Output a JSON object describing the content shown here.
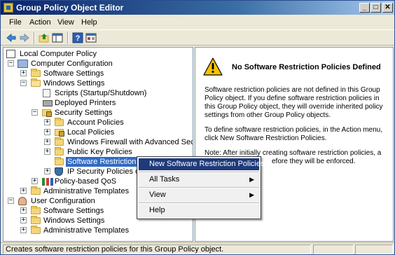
{
  "window": {
    "title": "Group Policy Object Editor",
    "minimize_glyph": "_",
    "maximize_glyph": "□",
    "close_glyph": "✕"
  },
  "menu": [
    "File",
    "Action",
    "View",
    "Help"
  ],
  "toolbar": {
    "icons": [
      "back-arrow-icon",
      "forward-arrow-icon",
      "up-folder-icon",
      "show-hide-tree-icon",
      "help-icon",
      "properties-icon"
    ]
  },
  "tree": {
    "root": "Local Computer Policy",
    "computer_configuration": "Computer Configuration",
    "software_settings": "Software Settings",
    "windows_settings": "Windows Settings",
    "scripts": "Scripts (Startup/Shutdown)",
    "deployed_printers": "Deployed Printers",
    "security_settings": "Security Settings",
    "account_policies": "Account Policies",
    "local_policies": "Local Policies",
    "windows_firewall": "Windows Firewall with Advanced Security",
    "public_key_policies": "Public Key Policies",
    "software_restriction": "Software Restriction Polic",
    "ip_security": "IP Security Policies on Lo",
    "policy_qos": "Policy-based QoS",
    "admin_templates": "Administrative Templates",
    "user_configuration": "User Configuration",
    "user_software_settings": "Software Settings",
    "user_windows_settings": "Windows Settings",
    "user_admin_templates": "Administrative Templates",
    "expand_glyph": "+",
    "collapse_glyph": "−"
  },
  "right_pane": {
    "heading": "No Software Restriction Policies Defined",
    "paragraph1": "Software restriction policies are not defined in this Group Policy object. If you define software restriction policies in this Group Policy object, they will override inherited policy settings from other Group Policy objects.",
    "paragraph2": "To define software restriction policies, in the Action menu, click New Software Restriction Policies.",
    "paragraph3": "Note: After initially creating software restriction policies, a",
    "paragraph3_tail": "efore they will be enforced."
  },
  "context_menu": {
    "items": [
      {
        "label": "New Software Restriction Policies",
        "submenu": false,
        "highlighted": true
      },
      {
        "label": "All Tasks",
        "submenu": true,
        "highlighted": false
      },
      {
        "label": "View",
        "submenu": true,
        "highlighted": false
      },
      {
        "label": "Help",
        "submenu": false,
        "highlighted": false
      }
    ],
    "submenu_glyph": "▶"
  },
  "status": {
    "text": "Creates software restriction policies for this Group Policy object."
  },
  "colors": {
    "title_gradient_start": "#0a246a",
    "selection": "#316ac5",
    "menu_highlight": "#1f3a7a",
    "warning_yellow": "#f5c400"
  }
}
